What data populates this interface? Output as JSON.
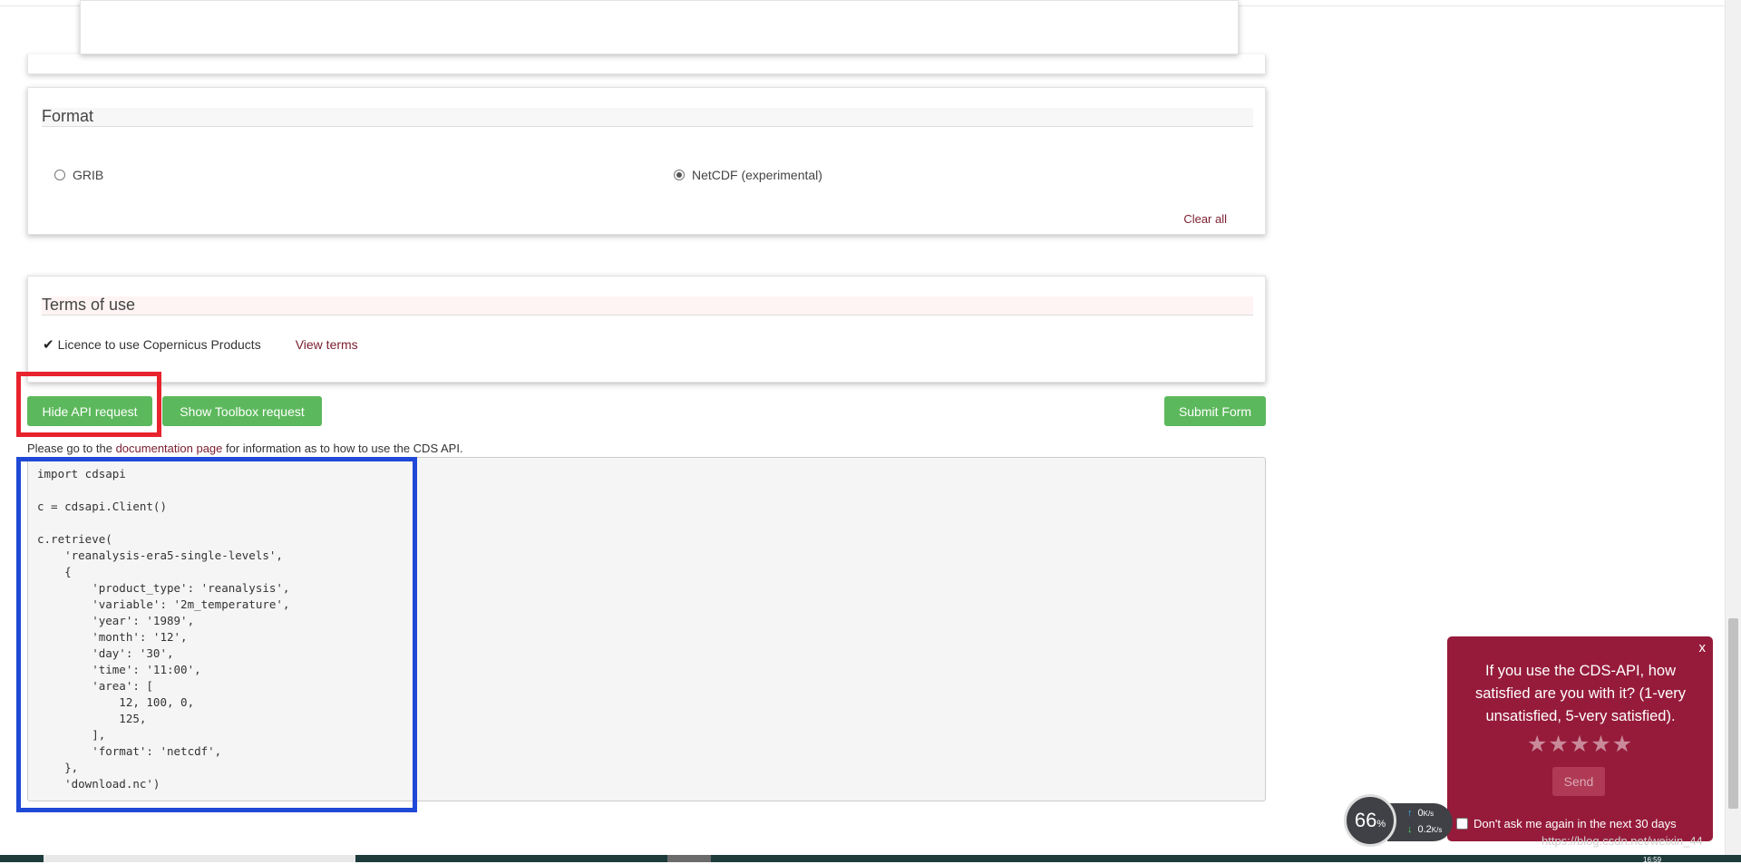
{
  "format": {
    "title": "Format",
    "options": [
      {
        "label": "GRIB",
        "checked": false
      },
      {
        "label": "NetCDF (experimental)",
        "checked": true
      }
    ],
    "clear_all": "Clear all"
  },
  "terms": {
    "title": "Terms of use",
    "licence": "Licence to use Copernicus Products",
    "view_terms": "View terms"
  },
  "buttons": {
    "hide_api": "Hide API request",
    "show_toolbox": "Show Toolbox request",
    "submit": "Submit Form"
  },
  "api_note": {
    "before": "Please go to the ",
    "link": "documentation page",
    "after": " for information as to how to use the CDS API."
  },
  "code": "import cdsapi\n\nc = cdsapi.Client()\n\nc.retrieve(\n    'reanalysis-era5-single-levels',\n    {\n        'product_type': 'reanalysis',\n        'variable': '2m_temperature',\n        'year': '1989',\n        'month': '12',\n        'day': '30',\n        'time': '11:00',\n        'area': [\n            12, 100, 0,\n            125,\n        ],\n        'format': 'netcdf',\n    },\n    'download.nc')",
  "survey": {
    "close": "x",
    "question": "If you use the CDS-API, how satisfied are you with it? (1-very unsatisfied, 5-very satisfied).",
    "stars": "★★★★★",
    "send": "Send",
    "dont_ask": "Don't ask me again in the next 30 days"
  },
  "speed": {
    "percent": "66",
    "percent_unit": "%",
    "up": "0",
    "up_unit": "K/s",
    "down": "0.2",
    "down_unit": "K/s"
  },
  "watermark": "https://blog.csdn.net/weixin_44",
  "taskbar_time": "16:59",
  "colors": {
    "accent_green": "#5cb85c",
    "link_red": "#7a1d2e",
    "survey_bg": "#961b3a",
    "highlight_red": "#e8232e",
    "highlight_blue": "#1f49d6"
  }
}
